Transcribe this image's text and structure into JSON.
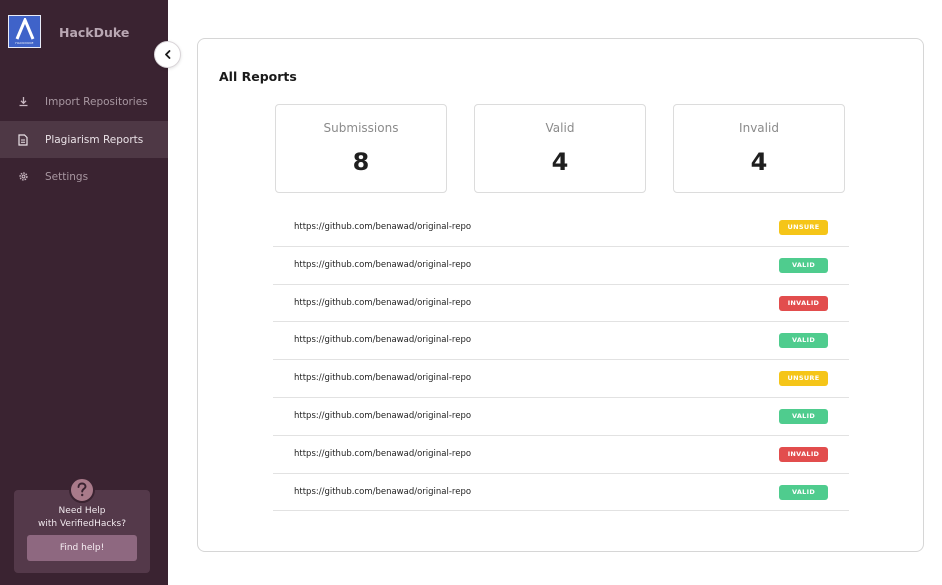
{
  "sidebar": {
    "logo_text": "HACKDUKE",
    "brand": "HackDuke",
    "nav": [
      {
        "label": "Import Repositories",
        "icon": "download-icon",
        "active": false
      },
      {
        "label": "Plagiarism Reports",
        "icon": "document-icon",
        "active": true
      },
      {
        "label": "Settings",
        "icon": "gear-icon",
        "active": false
      }
    ],
    "help": {
      "line1": "Need Help",
      "line2": "with VerifiedHacks?",
      "button": "Find help!"
    }
  },
  "main": {
    "title": "All Reports",
    "stats": [
      {
        "label": "Submissions",
        "value": "8"
      },
      {
        "label": "Valid",
        "value": "4"
      },
      {
        "label": "Invalid",
        "value": "4"
      }
    ],
    "reports": [
      {
        "url": "https://github.com/benawad/original-repo",
        "status": "UNSURE"
      },
      {
        "url": "https://github.com/benawad/original-repo",
        "status": "VALID"
      },
      {
        "url": "https://github.com/benawad/original-repo",
        "status": "INVALID"
      },
      {
        "url": "https://github.com/benawad/original-repo",
        "status": "VALID"
      },
      {
        "url": "https://github.com/benawad/original-repo",
        "status": "UNSURE"
      },
      {
        "url": "https://github.com/benawad/original-repo",
        "status": "VALID"
      },
      {
        "url": "https://github.com/benawad/original-repo",
        "status": "INVALID"
      },
      {
        "url": "https://github.com/benawad/original-repo",
        "status": "VALID"
      }
    ]
  },
  "colors": {
    "sidebar_bg": "#3a2331",
    "unsure": "#f5c518",
    "valid": "#4fcc8e",
    "invalid": "#e24d4d"
  }
}
